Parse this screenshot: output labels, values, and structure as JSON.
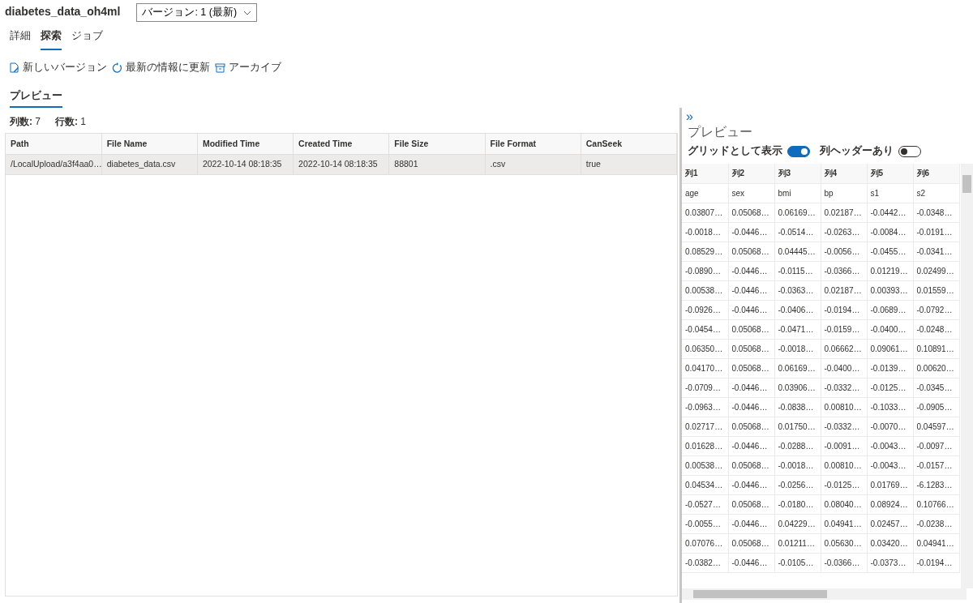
{
  "title": "diabetes_data_oh4ml",
  "version_select": {
    "value": "バージョン: 1 (最新)"
  },
  "tabs": [
    {
      "label": "詳細",
      "selected": false
    },
    {
      "label": "探索",
      "selected": true
    },
    {
      "label": "ジョブ",
      "selected": false
    }
  ],
  "toolbar": [
    {
      "label": "新しいバージョン",
      "kind": "new"
    },
    {
      "label": "最新の情報に更新",
      "kind": "refresh"
    },
    {
      "label": "アーカイブ",
      "kind": "archive"
    }
  ],
  "preview_tab": {
    "label": "プレビュー",
    "selected": true
  },
  "counts": [
    "**列数:** 7",
    "**行数:** 1"
  ],
  "table": {
    "columns": [
      "Path",
      "File Name",
      "Modified Time",
      "Created Time",
      "File Size",
      "File Format",
      "CanSeek"
    ],
    "rows": [
      {
        "selected": true,
        "cells": [
          "/LocalUpload/a3f4aa0…",
          "diabetes_data.csv",
          "2022-10-14 08:18:35",
          "2022-10-14 08:18:35",
          "88801",
          ".csv",
          "true"
        ]
      }
    ]
  },
  "panel": {
    "collapse": "»",
    "title": "プレビュー",
    "toggles": [
      {
        "label": "グリッドとして表示",
        "on": true
      },
      {
        "label": "列ヘッダーあり",
        "on": false
      }
    ],
    "grid": {
      "columns": [
        "列1",
        "列2",
        "列3",
        "列4",
        "列5",
        "列6"
      ],
      "rows": [
        [
          "age",
          "sex",
          "bmi",
          "bp",
          "s1",
          "s2"
        ],
        [
          "0.03807…",
          "0.05068…",
          "0.06169…",
          "0.02187…",
          "-0.0442…",
          "-0.0348…"
        ],
        [
          "-0.0018…",
          "-0.0446…",
          "-0.0514…",
          "-0.0263…",
          "-0.0084…",
          "-0.0191…"
        ],
        [
          "0.08529…",
          "0.05068…",
          "0.04445…",
          "-0.0056…",
          "-0.0455…",
          "-0.0341…"
        ],
        [
          "-0.0890…",
          "-0.0446…",
          "-0.0115…",
          "-0.0366…",
          "0.01219…",
          "0.02499…"
        ],
        [
          "0.00538…",
          "-0.0446…",
          "-0.0363…",
          "0.02187…",
          "0.00393…",
          "0.01559…"
        ],
        [
          "-0.0926…",
          "-0.0446…",
          "-0.0406…",
          "-0.0194…",
          "-0.0689…",
          "-0.0792…"
        ],
        [
          "-0.0454…",
          "0.05068…",
          "-0.0471…",
          "-0.0159…",
          "-0.0400…",
          "-0.0248…"
        ],
        [
          "0.06350…",
          "0.05068…",
          "-0.0018…",
          "0.06662…",
          "0.09061…",
          "0.10891…"
        ],
        [
          "0.04170…",
          "0.05068…",
          "0.06169…",
          "-0.0400…",
          "-0.0139…",
          "0.00620…"
        ],
        [
          "-0.0709…",
          "-0.0446…",
          "0.03906…",
          "-0.0332…",
          "-0.0125…",
          "-0.0345…"
        ],
        [
          "-0.0963…",
          "-0.0446…",
          "-0.0838…",
          "0.00810…",
          "-0.1033…",
          "-0.0905…"
        ],
        [
          "0.02717…",
          "0.05068…",
          "0.01750…",
          "-0.0332…",
          "-0.0070…",
          "0.04597…"
        ],
        [
          "0.01628…",
          "-0.0446…",
          "-0.0288…",
          "-0.0091…",
          "-0.0043…",
          "-0.0097…"
        ],
        [
          "0.00538…",
          "0.05068…",
          "-0.0018…",
          "0.00810…",
          "-0.0043…",
          "-0.0157…"
        ],
        [
          "0.04534…",
          "-0.0446…",
          "-0.0256…",
          "-0.0125…",
          "0.01769…",
          "-6.1283…"
        ],
        [
          "-0.0527…",
          "0.05068…",
          "-0.0180…",
          "0.08040…",
          "0.08924…",
          "0.10766…"
        ],
        [
          "-0.0055…",
          "-0.0446…",
          "0.04229…",
          "0.04941…",
          "0.02457…",
          "-0.0238…"
        ],
        [
          "0.07076…",
          "0.05068…",
          "0.01211…",
          "0.05630…",
          "0.03420…",
          "0.04941…"
        ],
        [
          "-0.0382…",
          "-0.0446…",
          "-0.0105…",
          "-0.0366…",
          "-0.0373…",
          "-0.0194…"
        ]
      ]
    }
  }
}
